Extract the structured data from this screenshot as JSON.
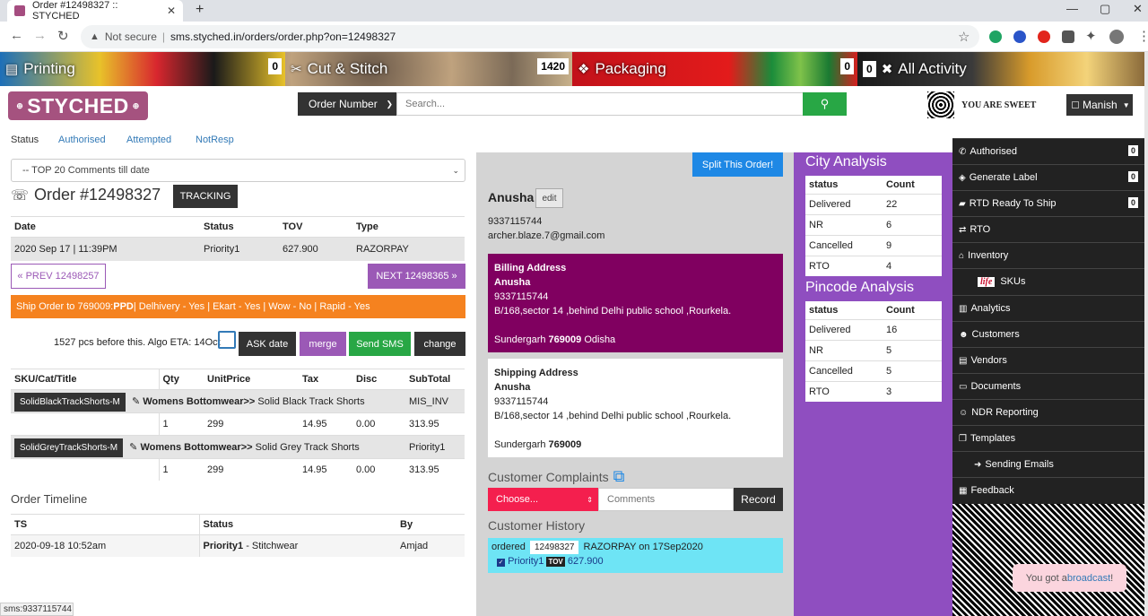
{
  "browser": {
    "tab_title": "Order #12498327 :: STYCHED",
    "url_warning": "Not secure",
    "url": "sms.styched.in/orders/order.php?on=12498327"
  },
  "banners": [
    {
      "label": "Printing",
      "count": "0"
    },
    {
      "label": "Cut & Stitch",
      "count": "1420"
    },
    {
      "label": "Packaging",
      "count": "0"
    },
    {
      "label": "All Activity",
      "count": ""
    }
  ],
  "header": {
    "logo": "STYCHED",
    "order_select": "Order Number",
    "search_placeholder": "Search...",
    "sweet_text": "YOU ARE SWEET",
    "user": "Manish"
  },
  "status_tabs": [
    "Status",
    "Authorised",
    "Attempted",
    "NotResp"
  ],
  "comments_select": "-- TOP 20 Comments till date",
  "order": {
    "title": "Order #12498327",
    "tracking_label": "TRACKING",
    "headers": [
      "Date",
      "Status",
      "TOV",
      "Type"
    ],
    "row": [
      "2020 Sep 17 | 11:39PM",
      "Priority1",
      "627.900",
      "RAZORPAY"
    ],
    "prev_label": "« PREV 12498257",
    "next_label": "NEXT 12498365 »"
  },
  "ship": {
    "prefix": "Ship Order to 769009: ",
    "mode": "PPD",
    "rest": " | Delhivery - Yes | Ekart - Yes | Wow - No | Rapid - Yes"
  },
  "actions": {
    "pcs_text": "1527 pcs before this. Algo ETA: 14Oct",
    "ask_date": "ASK date",
    "merge": "merge",
    "send_sms": "Send SMS",
    "change": "change"
  },
  "items": {
    "headers": [
      "SKU/Cat/Title",
      "Qty",
      "UnitPrice",
      "Tax",
      "Disc",
      "SubTotal"
    ],
    "rows": [
      {
        "sku": "SolidBlackTrackShorts-M",
        "cat": "Womens Bottomwear",
        "title": "Solid Black Track Shorts",
        "tag": "MIS_INV",
        "qty": "1",
        "price": "299",
        "tax": "14.95",
        "disc": "0.00",
        "subtotal": "313.95"
      },
      {
        "sku": "SolidGreyTrackShorts-M",
        "cat": "Womens Bottomwear",
        "title": "Solid Grey Track Shorts",
        "tag": "Priority1",
        "qty": "1",
        "price": "299",
        "tax": "14.95",
        "disc": "0.00",
        "subtotal": "313.95"
      }
    ]
  },
  "timeline": {
    "title": "Order Timeline",
    "headers": [
      "TS",
      "Status",
      "By"
    ],
    "rows": [
      {
        "ts": "2020-09-18 10:52am",
        "status": "Priority1",
        "status_rest": " - Stitchwear",
        "by": "Amjad"
      }
    ]
  },
  "status_bar": "sms:9337115744",
  "customer": {
    "split_label": "Split This Order!",
    "name": "Anusha",
    "edit_label": "edit",
    "phone": "9337115744",
    "email": "archer.blaze.7@gmail.com",
    "billing": {
      "title": "Billing Address",
      "name": "Anusha",
      "phone": "9337115744",
      "line1": "B/168,sector 14 ,behind Delhi public school ,Rourkela.",
      "city": "Sundergarh ",
      "pin": "769009",
      "state": " Odisha"
    },
    "shipping": {
      "title": "Shipping Address",
      "name": "Anusha",
      "phone": "9337115744",
      "line1": "B/168,sector 14 ,behind Delhi public school ,Rourkela.",
      "city": "Sundergarh ",
      "pin": "769009"
    },
    "complaints_title": "Customer Complaints",
    "choose_label": "Choose...",
    "comments_placeholder": "Comments",
    "record_label": "Record",
    "history_title": "Customer History",
    "history": {
      "ordered": "ordered",
      "order_id": "12498327",
      "desc": "RAZORPAY on 17Sep2020",
      "status": "Priority1",
      "tov_tag": "TOV",
      "tov": "627.900"
    }
  },
  "city_analysis": {
    "title": "City Analysis",
    "headers": [
      "status",
      "Count"
    ],
    "rows": [
      [
        "Delivered",
        "22"
      ],
      [
        "NR",
        "6"
      ],
      [
        "Cancelled",
        "9"
      ],
      [
        "RTO",
        "4"
      ]
    ]
  },
  "pincode_analysis": {
    "title": "Pincode Analysis",
    "headers": [
      "status",
      "Count"
    ],
    "rows": [
      [
        "Delivered",
        "16"
      ],
      [
        "NR",
        "5"
      ],
      [
        "Cancelled",
        "5"
      ],
      [
        "RTO",
        "3"
      ]
    ]
  },
  "sidebar": [
    {
      "icon": "phone-icon",
      "glyph": "✆",
      "label": "Authorised",
      "badge": "0"
    },
    {
      "icon": "tag-icon",
      "glyph": "◈",
      "label": "Generate Label",
      "badge": "0"
    },
    {
      "icon": "truck-icon",
      "glyph": "▰",
      "label": "RTD Ready To Ship",
      "badge": "0"
    },
    {
      "icon": "swap-icon",
      "glyph": "⇄",
      "label": "RTO",
      "badge": ""
    },
    {
      "icon": "home-icon",
      "glyph": "⌂",
      "label": "Inventory",
      "badge": ""
    },
    {
      "icon": "life-logo-icon",
      "glyph": "life",
      "label": "SKUs",
      "badge": ""
    },
    {
      "icon": "barcode-icon",
      "glyph": "▥",
      "label": "Analytics",
      "badge": ""
    },
    {
      "icon": "users-icon",
      "glyph": "☻",
      "label": "Customers",
      "badge": ""
    },
    {
      "icon": "book-icon",
      "glyph": "▤",
      "label": "Vendors",
      "badge": ""
    },
    {
      "icon": "card-icon",
      "glyph": "▭",
      "label": "Documents",
      "badge": ""
    },
    {
      "icon": "user-icon",
      "glyph": "☺",
      "label": "NDR Reporting",
      "badge": ""
    },
    {
      "icon": "copy-icon",
      "glyph": "❐",
      "label": "Templates",
      "badge": ""
    },
    {
      "icon": "arrow-right-icon",
      "glyph": "➜",
      "label": "Sending Emails",
      "badge": ""
    },
    {
      "icon": "table-icon",
      "glyph": "▦",
      "label": "Feedback",
      "badge": ""
    }
  ],
  "toast": {
    "prefix": "You got a ",
    "link": "broadcast",
    "suffix": "!"
  }
}
